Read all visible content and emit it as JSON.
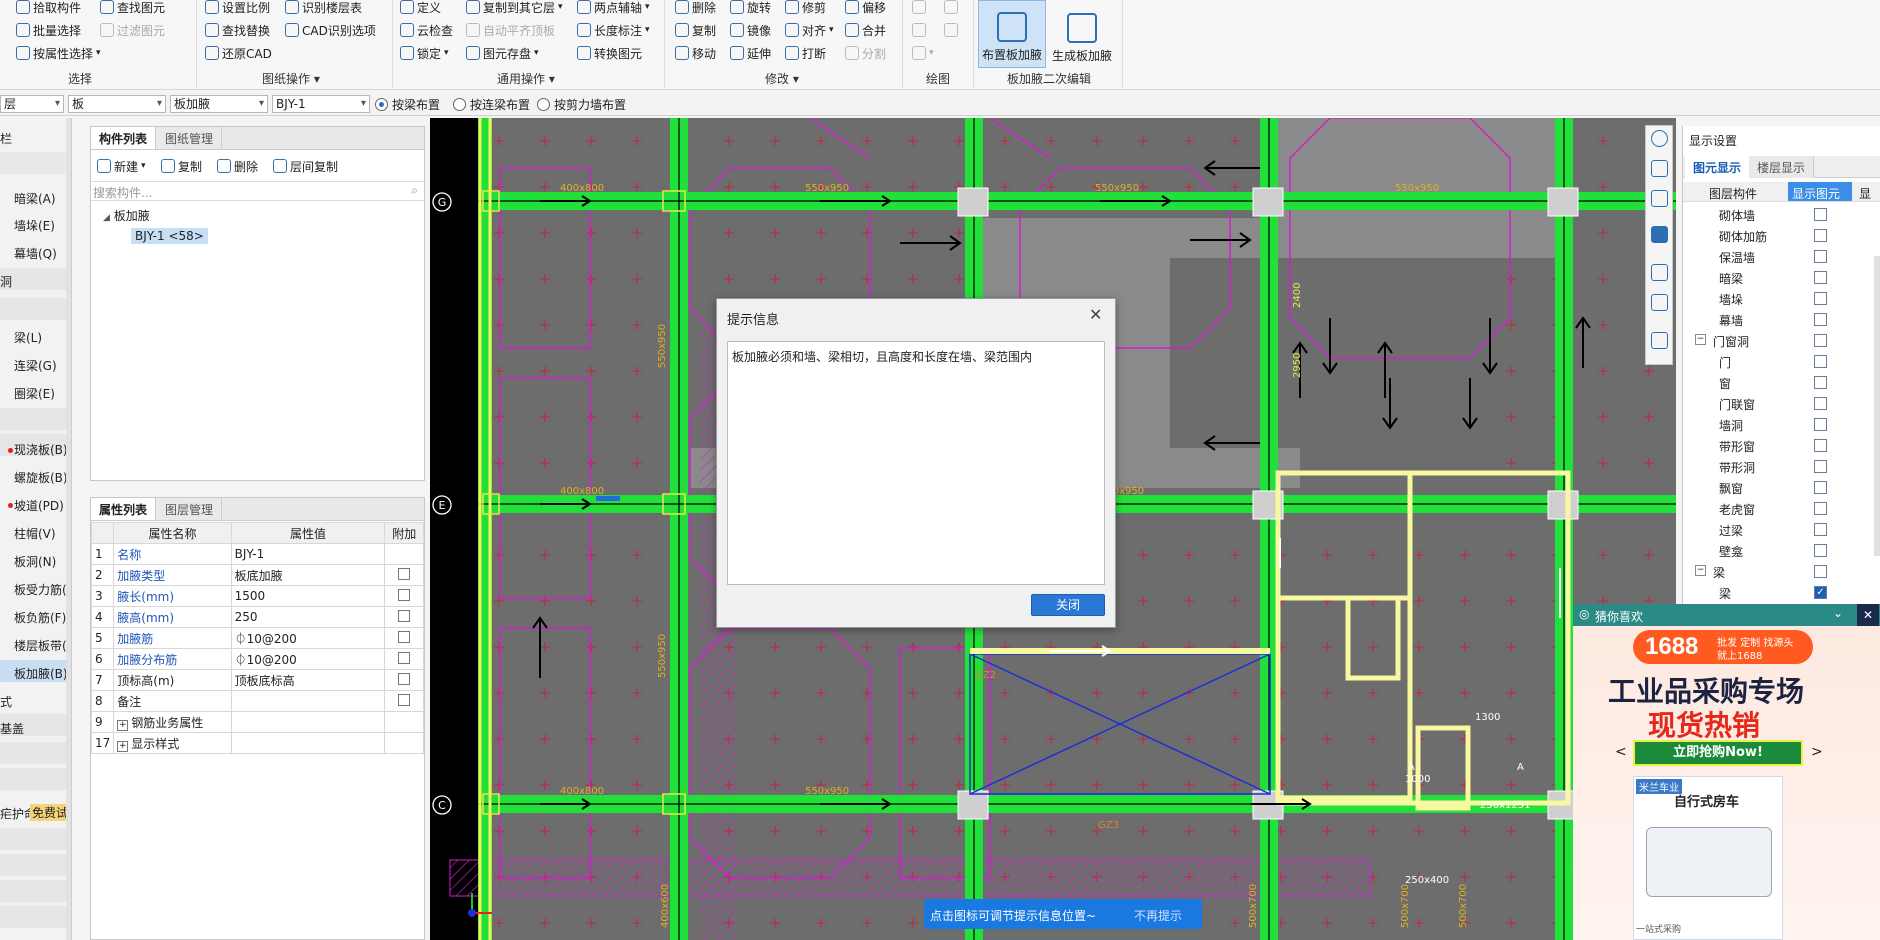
{
  "colors": {
    "accent": "#2b78d4",
    "beam": "#22e03a",
    "canvas_bg": "#6a6a6a",
    "magenta": "#d21ed2"
  },
  "ribbon": {
    "select": {
      "label": "选择",
      "items": [
        "拾取构件",
        "批量选择",
        "按属性选择",
        "查找图元",
        "过滤图元"
      ]
    },
    "drawing_ops": {
      "label": "图纸操作",
      "items": [
        "设置比例",
        "查找替换",
        "还原CAD",
        "识别楼层表",
        "CAD识别选项"
      ]
    },
    "common_ops": {
      "label": "通用操作",
      "items": [
        "定义",
        "云检查",
        "锁定",
        "复制到其它层",
        "自动平齐顶板",
        "图元存盘",
        "两点辅轴",
        "长度标注",
        "转换图元"
      ]
    },
    "modify": {
      "label": "修改",
      "items": [
        "删除",
        "复制",
        "移动",
        "旋转",
        "镜像",
        "延伸",
        "修剪",
        "对齐",
        "打断",
        "偏移",
        "合并",
        "分割"
      ]
    },
    "draw": {
      "label": "绘图"
    },
    "haunch": {
      "label": "板加腋二次编辑",
      "buttons": [
        "布置板加腋",
        "生成板加腋"
      ]
    }
  },
  "selector_bar": {
    "dropdowns": [
      "层",
      "板",
      "板加腋",
      "BJY-1"
    ],
    "radios": [
      "按梁布置",
      "按连梁布置",
      "按剪力墙布置"
    ],
    "selected_radio": 0
  },
  "left_nav": {
    "items": [
      "暗梁(A)",
      "墙垛(E)",
      "幕墙(Q)",
      "洞",
      "梁(L)",
      "连梁(G)",
      "圈梁(E)",
      "现浇板(B)",
      "螺旋板(B)",
      "坡道(PD)",
      "柱帽(V)",
      "板洞(N)",
      "板受力筋(S",
      "板负筋(F)",
      "楼层板带(H",
      "板加腋(B)",
      "式",
      "基盖",
      "疟护命",
      "免费试用"
    ],
    "header": "栏"
  },
  "component_panel": {
    "tabs": [
      "构件列表",
      "图纸管理"
    ],
    "toolbar": [
      "新建",
      "复制",
      "删除",
      "层间复制"
    ],
    "search_placeholder": "搜索构件...",
    "tree_root": "板加腋",
    "tree_child": "BJY-1 <58>"
  },
  "property_panel": {
    "tabs": [
      "属性列表",
      "图层管理"
    ],
    "headers": [
      "属性名称",
      "属性值",
      "附加"
    ],
    "rows": [
      {
        "no": "1",
        "name": "名称",
        "value": "BJY-1",
        "blue": true,
        "check": false
      },
      {
        "no": "2",
        "name": "加腋类型",
        "value": "板底加腋",
        "blue": true,
        "check": true
      },
      {
        "no": "3",
        "name": "腋长(mm)",
        "value": "1500",
        "blue": true,
        "check": true
      },
      {
        "no": "4",
        "name": "腋高(mm)",
        "value": "250",
        "blue": true,
        "check": true
      },
      {
        "no": "5",
        "name": "加腋筋",
        "value": "⏀10@200",
        "blue": true,
        "check": true
      },
      {
        "no": "6",
        "name": "加腋分布筋",
        "value": "⏀10@200",
        "blue": true,
        "check": true
      },
      {
        "no": "7",
        "name": "顶标高(m)",
        "value": "顶板底标高",
        "blue": false,
        "check": true
      },
      {
        "no": "8",
        "name": "备注",
        "value": "",
        "blue": false,
        "check": true
      },
      {
        "no": "9",
        "name": "钢筋业务属性",
        "value": "",
        "blue": false,
        "check": false
      },
      {
        "no": "17",
        "name": "显示样式",
        "value": "",
        "blue": false,
        "check": false
      }
    ]
  },
  "canvas": {
    "axis_labels": [
      "G",
      "E",
      "C"
    ],
    "dims": [
      "400x800",
      "550x950",
      "550x950",
      "550x950",
      "400x800",
      "550x950",
      "400x800",
      "550x950",
      "1300",
      "1000",
      "250x1251",
      "250x400",
      "2400",
      "2950",
      "GZ2",
      "GZ3",
      "A",
      "A"
    ],
    "extra_labels": [
      "550x950",
      "550x950",
      "400x600",
      "500x700",
      "500x700",
      "500x700"
    ]
  },
  "display_settings": {
    "title": "显示设置",
    "tabs": [
      "图元显示",
      "楼层显示"
    ],
    "headers": [
      "图层构件",
      "显示图元",
      "显"
    ],
    "rows": [
      {
        "label": "砌体墙",
        "level": 2,
        "checked": false
      },
      {
        "label": "砌体加筋",
        "level": 2,
        "checked": false
      },
      {
        "label": "保温墙",
        "level": 2,
        "checked": false
      },
      {
        "label": "暗梁",
        "level": 2,
        "checked": false
      },
      {
        "label": "墙垛",
        "level": 2,
        "checked": false
      },
      {
        "label": "幕墙",
        "level": 2,
        "checked": false
      },
      {
        "label": "门窗洞",
        "level": 1,
        "checked": false,
        "group": true
      },
      {
        "label": "门",
        "level": 2,
        "checked": false
      },
      {
        "label": "窗",
        "level": 2,
        "checked": false
      },
      {
        "label": "门联窗",
        "level": 2,
        "checked": false
      },
      {
        "label": "墙洞",
        "level": 2,
        "checked": false
      },
      {
        "label": "带形窗",
        "level": 2,
        "checked": false
      },
      {
        "label": "带形洞",
        "level": 2,
        "checked": false
      },
      {
        "label": "飘窗",
        "level": 2,
        "checked": false
      },
      {
        "label": "老虎窗",
        "level": 2,
        "checked": false
      },
      {
        "label": "过梁",
        "level": 2,
        "checked": false
      },
      {
        "label": "壁龛",
        "level": 2,
        "checked": false
      },
      {
        "label": "梁",
        "level": 1,
        "checked": false,
        "group": true
      },
      {
        "label": "梁",
        "level": 2,
        "checked": true
      }
    ]
  },
  "dialog": {
    "title": "提示信息",
    "message": "板加腋必须和墙、梁相切，且高度和长度在墙、梁范围内",
    "close_label": "关闭"
  },
  "toast": {
    "text": "点击图标可调节提示信息位置~",
    "dismiss": "不再提示"
  },
  "ad": {
    "header": "猜你喜欢",
    "logo_main": "1688",
    "logo_tags": [
      "批发",
      "定制",
      "找源头",
      "就上1688"
    ],
    "headline": "工业品采购专场",
    "subheadline": "现货热销",
    "cta": "立即抢购Now!",
    "card_brand": "米兰车业",
    "card_title": "自行式房车",
    "card_footer": "一站式采购"
  }
}
